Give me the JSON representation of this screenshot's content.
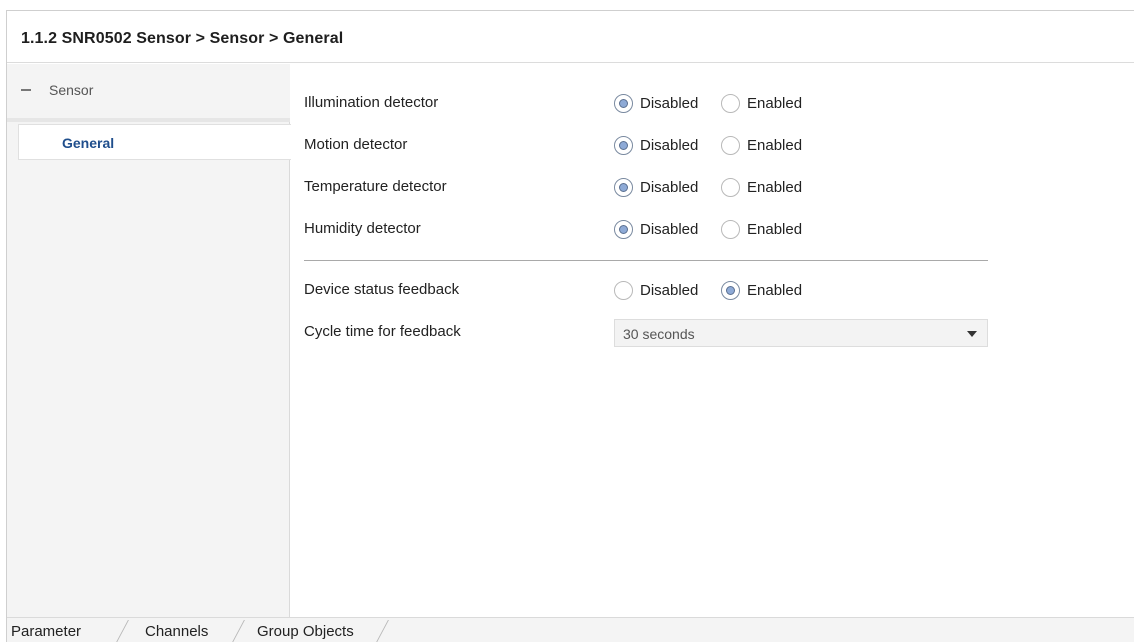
{
  "header": {
    "title": "1.1.2 SNR0502 Sensor > Sensor > General"
  },
  "sidebar": {
    "node": {
      "label": "Sensor",
      "icon": "minus-icon"
    },
    "child": {
      "label": "General"
    }
  },
  "options": {
    "disabled": "Disabled",
    "enabled": "Enabled"
  },
  "params": [
    {
      "label": "Illumination detector",
      "value": "Disabled"
    },
    {
      "label": "Motion detector",
      "value": "Disabled"
    },
    {
      "label": "Temperature detector",
      "value": "Disabled"
    },
    {
      "label": "Humidity detector",
      "value": "Disabled"
    },
    {
      "label": "Device status feedback",
      "value": "Enabled"
    }
  ],
  "cycle": {
    "label": "Cycle time for feedback",
    "value": "30 seconds"
  },
  "tabs": [
    {
      "label": "Parameter"
    },
    {
      "label": "Channels"
    },
    {
      "label": "Group Objects"
    }
  ],
  "colors": {
    "accent": "#1f4e8c",
    "radio_fill": "#8eaad6"
  }
}
